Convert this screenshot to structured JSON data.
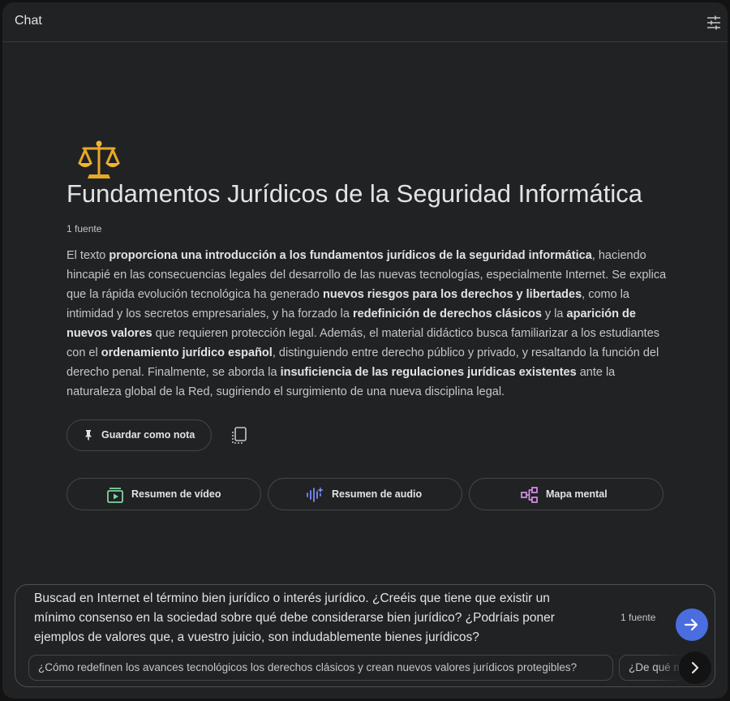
{
  "header": {
    "title": "Chat"
  },
  "notebook": {
    "title": "Fundamentos Jurídicos de la Seguridad Informática",
    "source_count": "1 fuente",
    "summary": [
      {
        "t": "El texto ",
        "b": false
      },
      {
        "t": "proporciona una introducción a los fundamentos jurídicos de la seguridad informática",
        "b": true
      },
      {
        "t": ", haciendo hincapié en las consecuencias legales del desarrollo de las nuevas tecnologías, especialmente Internet. Se explica que la rápida evolución tecnológica ha generado ",
        "b": false
      },
      {
        "t": "nuevos riesgos para los derechos y libertades",
        "b": true
      },
      {
        "t": ", como la intimidad y los secretos empresariales, y ha forzado la ",
        "b": false
      },
      {
        "t": "redefinición de derechos clásicos",
        "b": true
      },
      {
        "t": " y la ",
        "b": false
      },
      {
        "t": "aparición de nuevos valores",
        "b": true
      },
      {
        "t": " que requieren protección legal. Además, el material didáctico busca familiarizar a los estudiantes con el ",
        "b": false
      },
      {
        "t": "ordenamiento jurídico español",
        "b": true
      },
      {
        "t": ", distinguiendo entre derecho público y privado, y resaltando la función del derecho penal. Finalmente, se aborda la ",
        "b": false
      },
      {
        "t": "insuficiencia de las regulaciones jurídicas existentes",
        "b": true
      },
      {
        "t": " ante la naturaleza global de la Red, sugiriendo el surgimiento de una nueva disciplina legal.",
        "b": false
      }
    ]
  },
  "note_actions": {
    "save_label": "Guardar como nota"
  },
  "studio_actions": [
    {
      "label": "Resumen de vídeo",
      "icon": "video-summary-icon"
    },
    {
      "label": "Resumen de audio",
      "icon": "audio-summary-icon"
    },
    {
      "label": "Mapa mental",
      "icon": "mind-map-icon"
    }
  ],
  "composer": {
    "query": "Buscad en Internet el término bien jurídico o interés jurídico. ¿Creéis que tiene que existir un mínimo consenso en la sociedad sobre qué debe considerarse bien jurídico? ¿Podríais poner ejemplos de valores que, a vuestro juicio, son indudablemente bienes jurídicos?",
    "source_count": "1 fuente",
    "suggestions": [
      "¿Cómo redefinen los avances tecnológicos los derechos clásicos y crean nuevos valores jurídicos protegibles?",
      "¿De qué m"
    ]
  },
  "colors": {
    "background": "#131314",
    "panel": "#212224",
    "send_button": "#4a6ee0",
    "video_icon": "#7fd3a0",
    "audio_icon": "#7b8cff",
    "mind_map_icon": "#d08ae0"
  }
}
